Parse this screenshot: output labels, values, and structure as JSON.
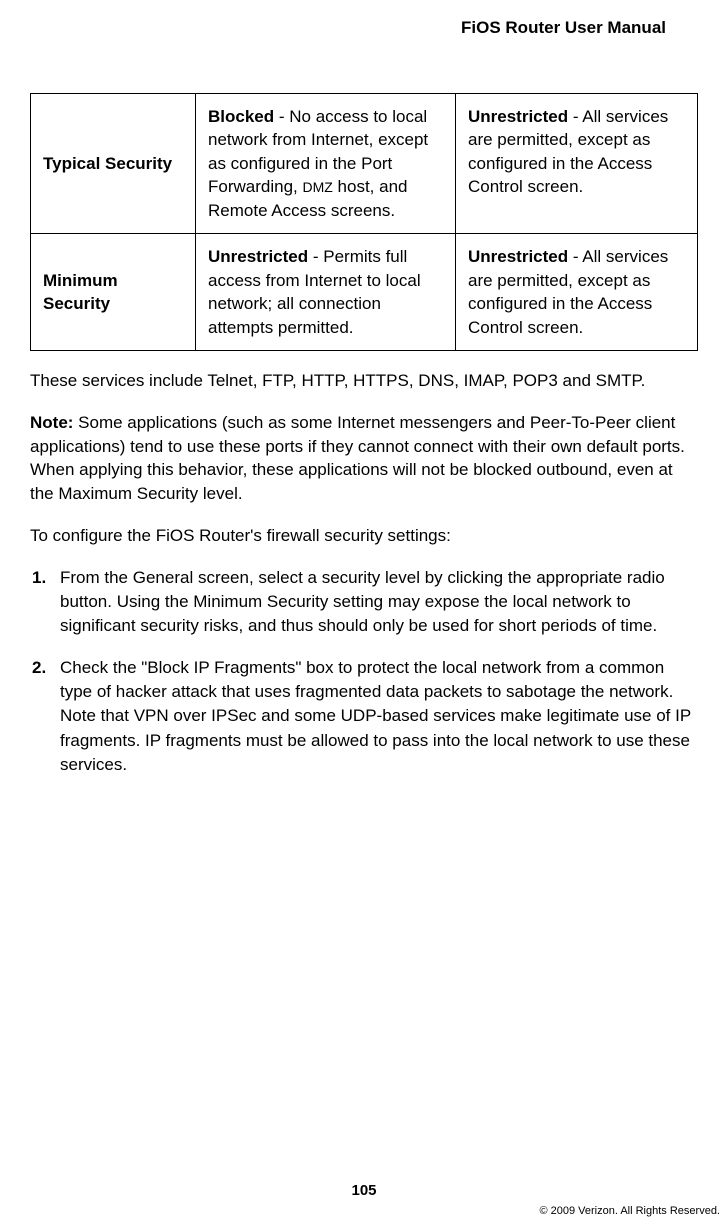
{
  "header": {
    "title": "FiOS Router User Manual"
  },
  "table": {
    "rows": [
      {
        "head": "Typical Security",
        "col2_lead": "Blocked",
        "col2_rest": " - No access to local network from Internet, except as configured in the Port Forwarding, ",
        "col2_sc": "DMZ",
        "col2_tail": " host, and Remote Access screens.",
        "col3_lead": "Unrestricted",
        "col3_rest": " - All services are permitted, except as configured in the Access Control screen."
      },
      {
        "head": "Minimum Security",
        "col2_lead": "Unrestricted",
        "col2_rest": " - Permits full access from Internet to local network; all connection attempts permitted.",
        "col2_sc": "",
        "col2_tail": "",
        "col3_lead": "Unrestricted",
        "col3_rest": " - All services are permitted, except as configured in the Access Control screen."
      }
    ]
  },
  "paragraphs": {
    "services": "These services include Telnet, FTP, HTTP, HTTPS, DNS, IMAP, POP3 and SMTP.",
    "note_label": "Note:",
    "note_text": " Some applications (such as some Internet messengers and Peer-To-Peer client applications) tend to use these ports if they cannot connect with their own default ports. When applying this behavior, these applications will not be blocked outbound, even at the Maximum Security level.",
    "configure": "To configure the FiOS Router's firewall security settings:"
  },
  "steps": [
    "From the General screen, select a security level by clicking the appropriate radio button. Using the Minimum Security setting may expose the local network to significant security risks, and thus should only be used for short periods of time.",
    "Check the \"Block IP Fragments\" box to protect the local network from a common type of hacker attack that uses fragmented data packets to sabotage the network. Note that VPN over IPSec and some UDP-based services make legitimate use of IP fragments. IP fragments must be allowed to pass into the local network to use these services."
  ],
  "footer": {
    "page": "105",
    "copyright": "© 2009 Verizon. All Rights Reserved."
  }
}
